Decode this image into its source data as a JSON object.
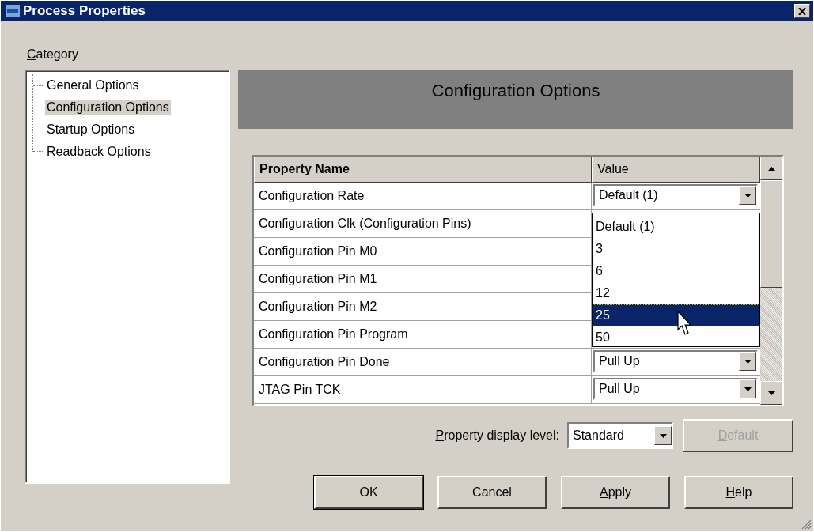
{
  "window": {
    "title": "Process Properties"
  },
  "category": {
    "label": "Category",
    "access_key": true
  },
  "tree": {
    "items": [
      {
        "label": "General Options",
        "selected": false
      },
      {
        "label": "Configuration Options",
        "selected": true
      },
      {
        "label": "Startup Options",
        "selected": false
      },
      {
        "label": "Readback Options",
        "selected": false
      }
    ]
  },
  "header": {
    "title": "Configuration Options"
  },
  "table": {
    "columns": [
      "Property Name",
      "Value"
    ],
    "rows": [
      {
        "name": "Configuration Rate",
        "value": "Default (1)"
      },
      {
        "name": "Configuration Clk (Configuration Pins)"
      },
      {
        "name": "Configuration Pin M0"
      },
      {
        "name": "Configuration Pin M1"
      },
      {
        "name": "Configuration Pin M2"
      },
      {
        "name": "Configuration Pin Program"
      },
      {
        "name": "Configuration Pin Done",
        "value": "Pull Up"
      },
      {
        "name": "JTAG Pin TCK",
        "value": "Pull Up"
      }
    ]
  },
  "dropdown": {
    "options": [
      {
        "label": "Default (1)",
        "selected": false
      },
      {
        "label": "3",
        "selected": false
      },
      {
        "label": "6",
        "selected": false
      },
      {
        "label": "12",
        "selected": false
      },
      {
        "label": "25",
        "selected": true
      },
      {
        "label": "50",
        "selected": false
      }
    ]
  },
  "display_level": {
    "label": "Property display level:",
    "access_key": true,
    "value": "Standard"
  },
  "buttons": [
    {
      "label": "Default",
      "disabled": true,
      "access_key": true,
      "default": false
    },
    {
      "label": "OK",
      "disabled": false,
      "access_key": false,
      "default": true
    },
    {
      "label": "Cancel",
      "disabled": false,
      "access_key": false,
      "default": false
    },
    {
      "label": "Apply",
      "disabled": false,
      "access_key": true,
      "default": false
    },
    {
      "label": "Help",
      "disabled": false,
      "access_key": true,
      "default": false
    }
  ]
}
